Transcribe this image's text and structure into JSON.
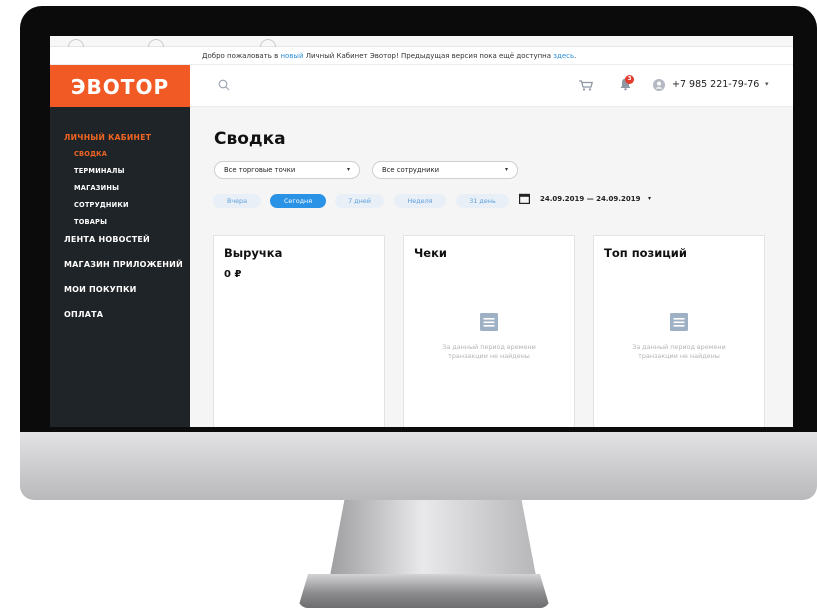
{
  "welcome": {
    "prefix": "Добро пожаловать в ",
    "link1": "новый",
    "middle": " Личный Кабинет Эвотор! Предыдущая версия пока ещё доступна ",
    "link2": "здесь",
    "suffix": "."
  },
  "brand": {
    "logo": "ЭВОТОР",
    "accent": "#F15A24",
    "sidebar_bg": "#1F2428"
  },
  "sidebar": {
    "section": "ЛИЧНЫЙ КАБИНЕТ",
    "sub_items": [
      {
        "label": "СВОДКА",
        "active": true
      },
      {
        "label": "ТЕРМИНАЛЫ",
        "active": false
      },
      {
        "label": "МАГАЗИНЫ",
        "active": false
      },
      {
        "label": "СОТРУДНИКИ",
        "active": false
      },
      {
        "label": "ТОВАРЫ",
        "active": false
      }
    ],
    "top_items": [
      "ЛЕНТА НОВОСТЕЙ",
      "МАГАЗИН ПРИЛОЖЕНИЙ",
      "МОИ ПОКУПКИ",
      "ОПЛАТА"
    ]
  },
  "header": {
    "search_icon": "search-icon",
    "notifications_count": "3",
    "phone": "+7 985 221-79-76",
    "caret": "▾"
  },
  "main": {
    "title": "Сводка",
    "filters": {
      "stores": "Все торговые точки",
      "employees": "Все сотрудники",
      "arrow": "▾"
    },
    "periods": [
      {
        "label": "Вчера",
        "active": false
      },
      {
        "label": "Сегодня",
        "active": true
      },
      {
        "label": "7 дней",
        "active": false
      },
      {
        "label": "Неделя",
        "active": false
      },
      {
        "label": "31 день",
        "active": false
      }
    ],
    "date_range": "24.09.2019 — 24.09.2019",
    "date_caret": "▾",
    "cards": [
      {
        "title": "Выручка",
        "value": "0 ₽",
        "empty_text": ""
      },
      {
        "title": "Чеки",
        "value": "",
        "empty_text": "За данный период времени транзакции не найдены"
      },
      {
        "title": "Топ позиций",
        "value": "",
        "empty_text": "За данный период времени транзакции не найдены"
      }
    ]
  }
}
